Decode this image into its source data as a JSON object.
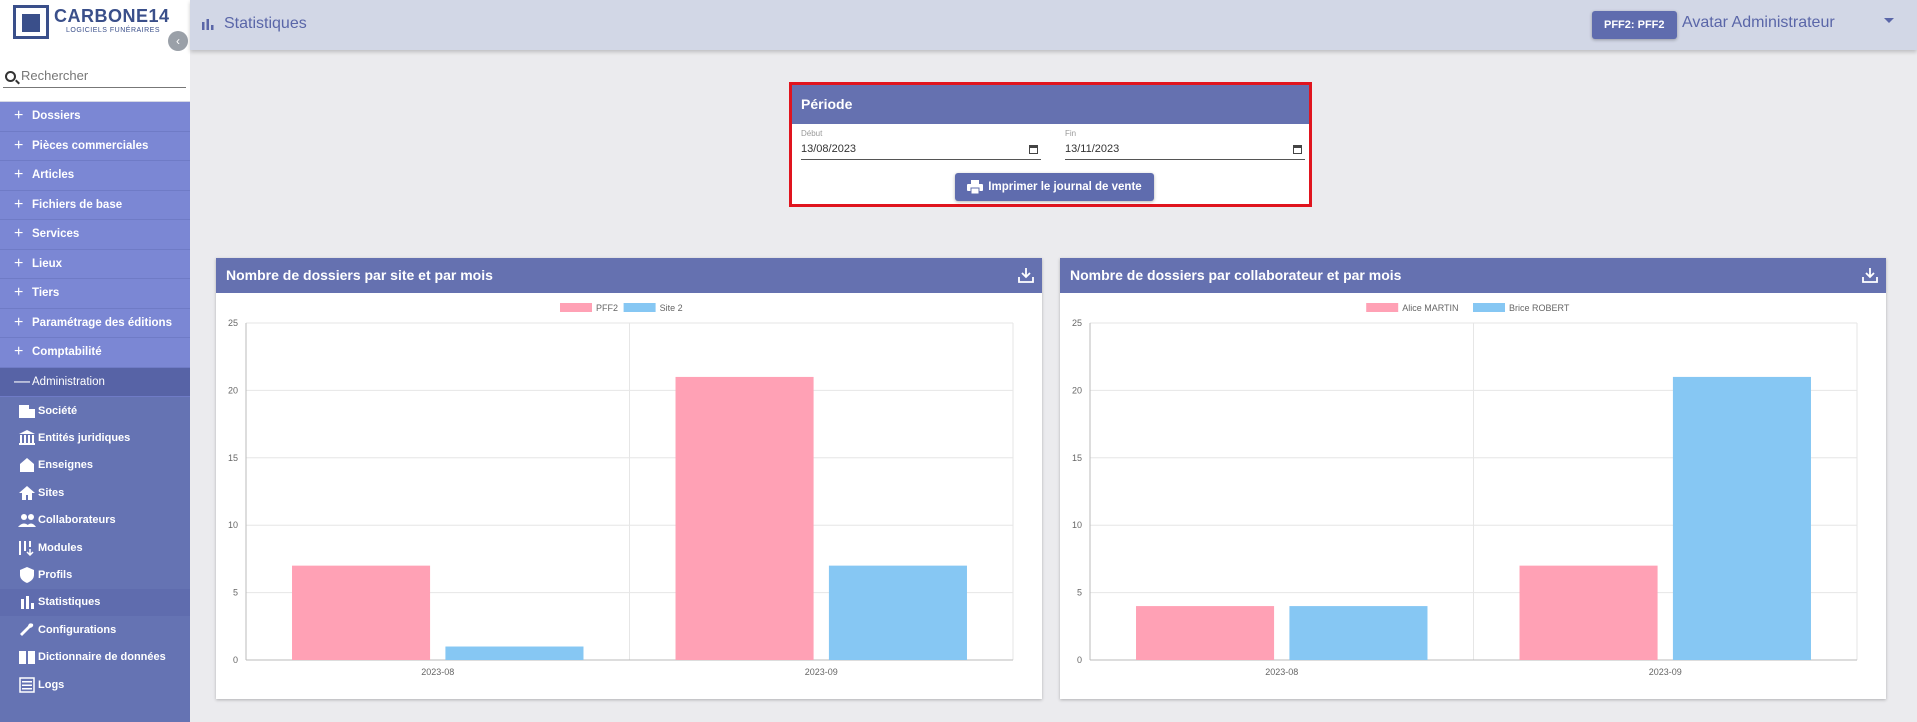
{
  "logo": {
    "text": "CARBONE14",
    "sub": "LOGICIELS FUNÉRAIRES"
  },
  "search": {
    "placeholder": "Rechercher"
  },
  "sidebar": {
    "menu": [
      "Dossiers",
      "Pièces commerciales",
      "Articles",
      "Fichiers de base",
      "Services",
      "Lieux",
      "Tiers",
      "Paramétrage des éditions",
      "Comptabilité"
    ],
    "open_section": "Administration",
    "sub_items": [
      {
        "label": "Société",
        "icon": "building-icon"
      },
      {
        "label": "Entités juridiques",
        "icon": "institution-icon"
      },
      {
        "label": "Enseignes",
        "icon": "storefront-icon"
      },
      {
        "label": "Sites",
        "icon": "home-icon"
      },
      {
        "label": "Collaborateurs",
        "icon": "people-icon"
      },
      {
        "label": "Modules",
        "icon": "modules-icon"
      },
      {
        "label": "Profils",
        "icon": "shield-icon"
      },
      {
        "label": "Statistiques",
        "icon": "bar-chart-icon"
      },
      {
        "label": "Configurations",
        "icon": "wrench-icon"
      },
      {
        "label": "Dictionnaire de données",
        "icon": "book-icon"
      },
      {
        "label": "Logs",
        "icon": "list-icon"
      }
    ],
    "active_item": "Statistiques"
  },
  "header": {
    "title": "Statistiques",
    "site_badge": "PFF2: PFF2",
    "avatar_text": "Avatar Administrateur"
  },
  "periode": {
    "title": "Période",
    "start_label": "Début",
    "start_value": "13/08/2023",
    "end_label": "Fin",
    "end_value": "13/11/2023",
    "print_label": "Imprimer le journal de vente"
  },
  "colors": {
    "pink": "#ffa1b5",
    "blue": "#86c7f3",
    "header": "#6571b0"
  },
  "charts": [
    {
      "title": "Nombre de dossiers par site et par mois"
    },
    {
      "title": "Nombre de dossiers par collaborateur et par mois"
    }
  ],
  "chart_data": [
    {
      "type": "bar",
      "title": "Nombre de dossiers par site et par mois",
      "categories": [
        "2023-08",
        "2023-09"
      ],
      "series": [
        {
          "name": "PFF2",
          "values": [
            7,
            21
          ],
          "color": "#ffa1b5"
        },
        {
          "name": "Site 2",
          "values": [
            1,
            7
          ],
          "color": "#86c7f3"
        }
      ],
      "ylim": [
        0,
        25
      ],
      "yticks": [
        0,
        5,
        10,
        15,
        20,
        25
      ],
      "legend": "top-center",
      "grid": true
    },
    {
      "type": "bar",
      "title": "Nombre de dossiers par collaborateur et par mois",
      "categories": [
        "2023-08",
        "2023-09"
      ],
      "series": [
        {
          "name": "Alice MARTIN",
          "values": [
            4,
            7
          ],
          "color": "#ffa1b5"
        },
        {
          "name": "Brice ROBERT",
          "values": [
            4,
            21
          ],
          "color": "#86c7f3"
        }
      ],
      "ylim": [
        0,
        25
      ],
      "yticks": [
        0,
        5,
        10,
        15,
        20,
        25
      ],
      "legend": "top-center",
      "grid": true
    }
  ]
}
